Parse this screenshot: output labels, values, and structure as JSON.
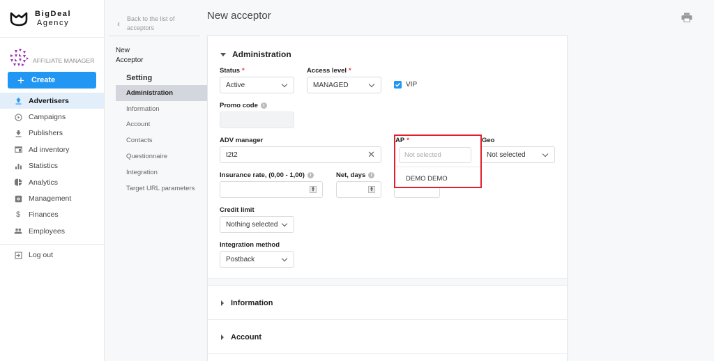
{
  "brand": {
    "name": "BigDeal",
    "sub": "Agency"
  },
  "role": {
    "label": "AFFILIATE MANAGER"
  },
  "create_button": {
    "label": "Create",
    "icon": "plus-icon"
  },
  "nav": {
    "items": [
      {
        "label": "Advertisers",
        "icon": "upload-icon",
        "active": true
      },
      {
        "label": "Campaigns",
        "icon": "play-circle-icon"
      },
      {
        "label": "Publishers",
        "icon": "download-icon"
      },
      {
        "label": "Ad inventory",
        "icon": "window-icon"
      },
      {
        "label": "Statistics",
        "icon": "bar-chart-icon"
      },
      {
        "label": "Analytics",
        "icon": "pie-chart-icon"
      },
      {
        "label": "Management",
        "icon": "settings-box-icon"
      },
      {
        "label": "Finances",
        "icon": "dollar-icon"
      },
      {
        "label": "Employees",
        "icon": "people-icon"
      }
    ],
    "logout": {
      "label": "Log out",
      "icon": "logout-icon"
    }
  },
  "subnav": {
    "back_label": "Back to the list of acceptors",
    "entity_title_line1": "New",
    "entity_title_line2": "Acceptor",
    "section": "Setting",
    "items": [
      {
        "label": "Administration",
        "active": true
      },
      {
        "label": "Information"
      },
      {
        "label": "Account"
      },
      {
        "label": "Contacts"
      },
      {
        "label": "Questionnaire"
      },
      {
        "label": "Integration"
      },
      {
        "label": "Target URL parameters"
      }
    ]
  },
  "page": {
    "title": "New acceptor",
    "print_icon": "printer-icon"
  },
  "form": {
    "section_title": "Administration",
    "status": {
      "label": "Status",
      "required": "*",
      "value": "Active"
    },
    "access_level": {
      "label": "Access level",
      "required": "*",
      "value": "MANAGED"
    },
    "vip": {
      "label": "VIP",
      "checked": true
    },
    "promo_code": {
      "label": "Promo code",
      "value": ""
    },
    "adv_manager": {
      "label": "ADV manager",
      "value": "t2t2"
    },
    "ap": {
      "label": "AP",
      "required": "*",
      "search_placeholder": "Not selected",
      "options": [
        "DEMO DEMO"
      ]
    },
    "geo": {
      "label": "Geo",
      "value": "Not selected"
    },
    "insurance_rate": {
      "label": "Insurance rate, (0,00 - 1,00)",
      "value": ""
    },
    "net_days": {
      "label": "Net, days",
      "value": ""
    },
    "credit_limit": {
      "label": "Credit limit",
      "value": "Nothing selected"
    },
    "integration_method": {
      "label": "Integration method",
      "value": "Postback"
    }
  },
  "collapsed_sections": [
    "Information",
    "Account"
  ],
  "colors": {
    "accent": "#2196f3",
    "highlight": "#e51e2b",
    "required": "#e53935"
  }
}
